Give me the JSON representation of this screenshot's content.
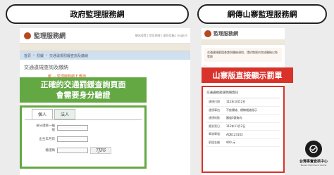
{
  "headers": {
    "left": "政府監理服務網",
    "right": "網傳山寨監理服務網"
  },
  "left_panel": {
    "site_title": "監理服務網",
    "top_links": "網站導覽 | 常見問答 | 意見信箱 | English",
    "breadcrumb": [
      "首頁",
      "罰鍰",
      "交通違規罰鍰查詢及繳納"
    ],
    "section_title": "交通違規查詢及繳納",
    "notice": "報 ··· 監理服務網 F 應用",
    "notice2": "...",
    "overlay_line1": "正確的交通罰鍰查詢頁面",
    "overlay_line2": "會需要身分驗證",
    "tabs": [
      "個人",
      "法人"
    ],
    "fields": {
      "id_label": "身分證統一編號",
      "birth_label": "出生年月日",
      "captcha_label": "驗證碼"
    },
    "captcha_text": "7JF6",
    "submit": "查詢"
  },
  "right_panel": {
    "site_title": "監理服務網",
    "alert": "交通違規罰鍰查詢與繳納須知，請於期限內完成繳納以免受罰",
    "alert2": "...",
    "red_banner": "山寨版直接顯示罰單",
    "fine_title": "交通違規罰鍰明細資訊",
    "fine_rows": [
      {
        "k": "違規日期",
        "v": "112年10月2日"
      },
      {
        "k": "違規事由",
        "v": "不依標誌、標線號誌指示"
      },
      {
        "k": "違規地點",
        "v": "國道3號南向"
      },
      {
        "k": "應到案日",
        "v": "112年11月2日"
      },
      {
        "k": "舉發單號",
        "v": "AQE123102"
      },
      {
        "k": "罰鍰金額",
        "v": "900 元"
      }
    ]
  },
  "watermark": {
    "name": "台灣事實查核中心",
    "sub": "Taiwan FactCheck Center"
  }
}
